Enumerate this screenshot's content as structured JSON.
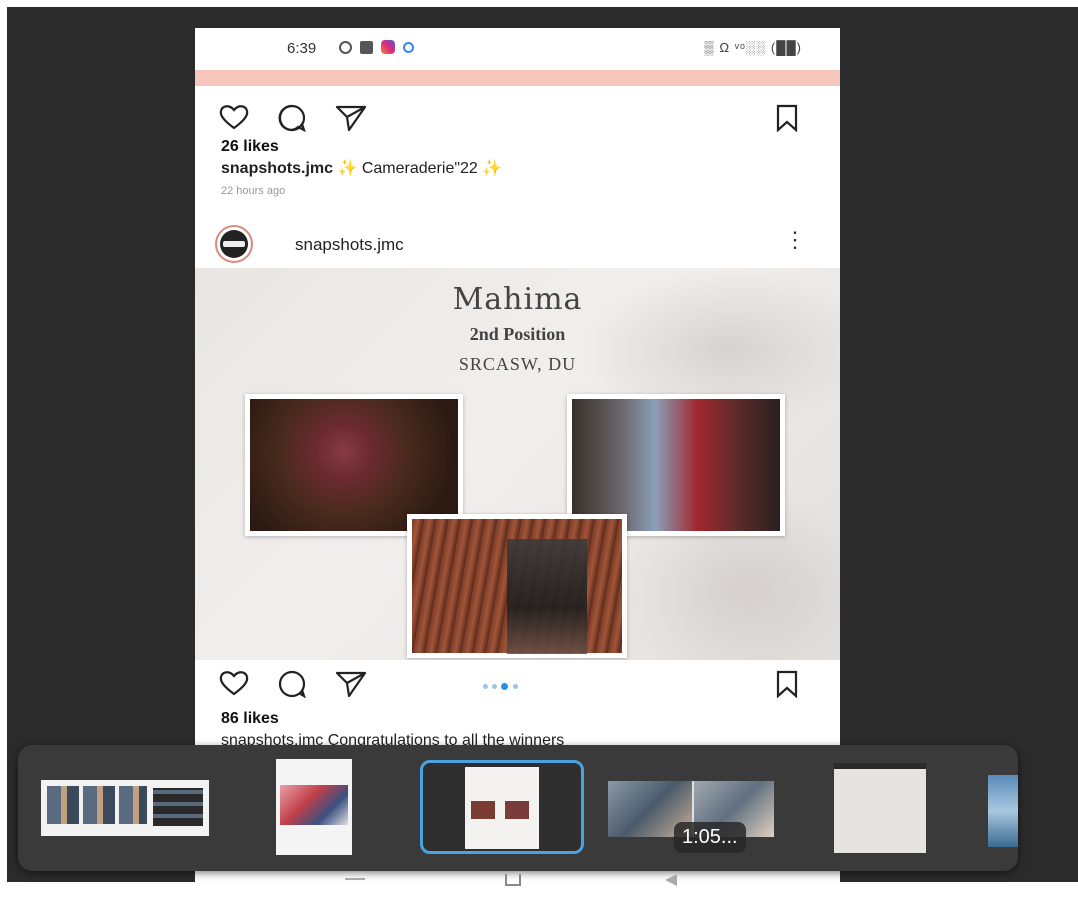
{
  "status_bar": {
    "time": "6:39",
    "right_icons": "▒ Ω ᵛᵒ░░ (██)"
  },
  "post1": {
    "likes": "26 likes",
    "username": "snapshots.jmc",
    "caption": "✨ Cameraderie\"22 ✨",
    "time_ago": "22 hours ago"
  },
  "post2": {
    "username": "snapshots.jmc",
    "menu": "⋮",
    "image_text": {
      "name": "Mahima",
      "position": "2nd Position",
      "college": "SRCASW, DU"
    },
    "likes": "86 likes",
    "caption_partial": "snapshots.jmc Congratulations to all the winners"
  },
  "recents": {
    "video_duration": "1:05..."
  },
  "colors": {
    "accent": "#4aa3e0",
    "pink_bar": "#f7c7bd",
    "recents_bg": "#3a3a3a"
  }
}
